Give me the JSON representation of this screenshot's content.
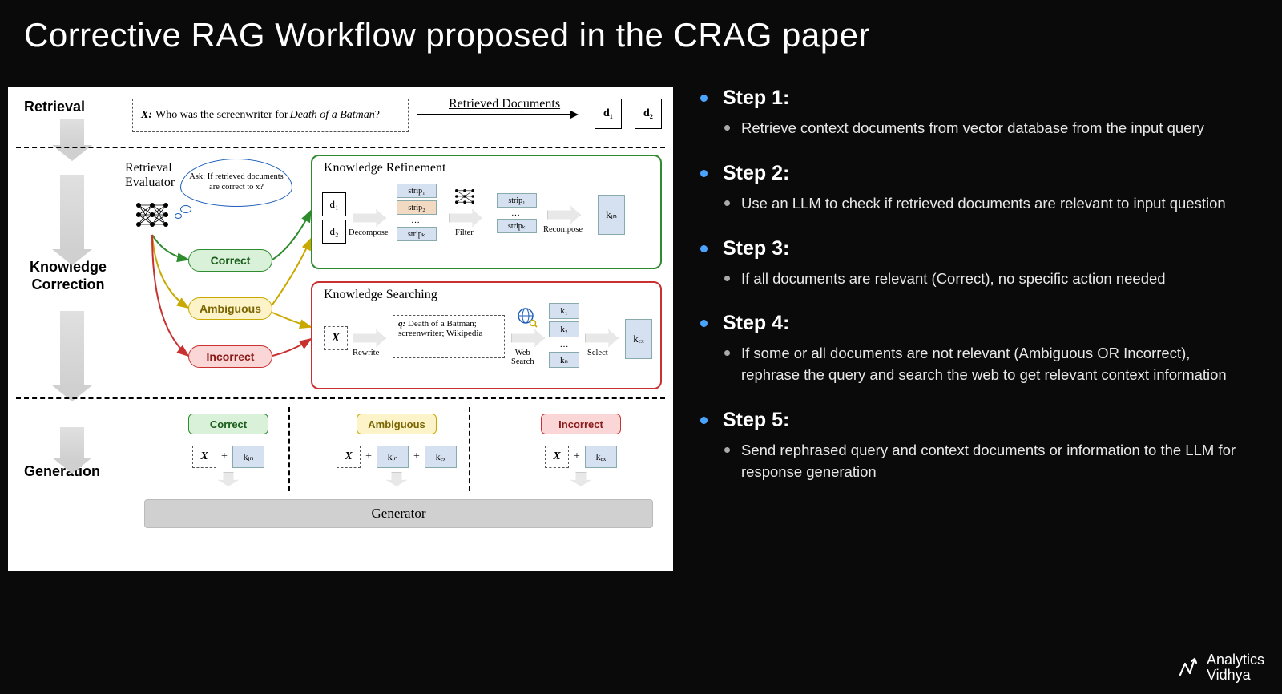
{
  "title": "Corrective RAG Workflow proposed in the CRAG paper",
  "brand": {
    "line1": "Analytics",
    "line2": "Vidhya"
  },
  "diagram": {
    "phases": {
      "retrieval": "Retrieval",
      "correction": "Knowledge\nCorrection",
      "generation": "Generation"
    },
    "query": {
      "x": "X:",
      "text": "Who was the screenwriter for ",
      "italic": "Death of a Batman",
      "tail": "?"
    },
    "retrieved_label": "Retrieved Documents",
    "docs": [
      "d₁",
      "d₂"
    ],
    "evaluator_label": "Retrieval\nEvaluator",
    "ask_bubble": "Ask: If retrieved documents are correct to x?",
    "badges": {
      "correct": "Correct",
      "ambiguous": "Ambiguous",
      "incorrect": "Incorrect"
    },
    "kr": {
      "title": "Knowledge Refinement",
      "docs": [
        "d₁",
        "d₂"
      ],
      "ops": [
        "Decompose",
        "Filter",
        "Recompose"
      ],
      "strips_left": [
        "strip₁",
        "strip₂",
        "…",
        "stripₖ"
      ],
      "strips_right": [
        "strip₁",
        "stripₖ"
      ],
      "kin": "kᵢₙ"
    },
    "ks": {
      "title": "Knowledge Searching",
      "x": "X",
      "rewrite": "Rewrite",
      "query_label": "q:",
      "query_text": "Death of a Batman; screenwriter; Wikipedia",
      "web_search": "Web\nSearch",
      "results": [
        "k₁",
        "k₂",
        "…",
        "kₙ"
      ],
      "select": "Select",
      "kex": "kₑₓ"
    },
    "generation": {
      "generator": "Generator",
      "plus": "+",
      "cols": [
        {
          "badge": "Correct",
          "terms": [
            "X",
            "kᵢₙ"
          ]
        },
        {
          "badge": "Ambiguous",
          "terms": [
            "X",
            "kᵢₙ",
            "kₑₓ"
          ]
        },
        {
          "badge": "Incorrect",
          "terms": [
            "X",
            "kₑₓ"
          ]
        }
      ]
    }
  },
  "steps": [
    {
      "title": "Step 1:",
      "body": "Retrieve context documents from vector database from the input query"
    },
    {
      "title": "Step 2:",
      "body": "Use an LLM to check if retrieved documents are relevant to input question"
    },
    {
      "title": "Step 3:",
      "body": "If all documents are relevant (Correct), no specific action needed"
    },
    {
      "title": "Step 4:",
      "body": "If some or all documents are not relevant (Ambiguous OR Incorrect), rephrase the query and search the web to get relevant context information"
    },
    {
      "title": "Step 5:",
      "body": "Send rephrased query and context documents or information to the LLM for response generation"
    }
  ]
}
